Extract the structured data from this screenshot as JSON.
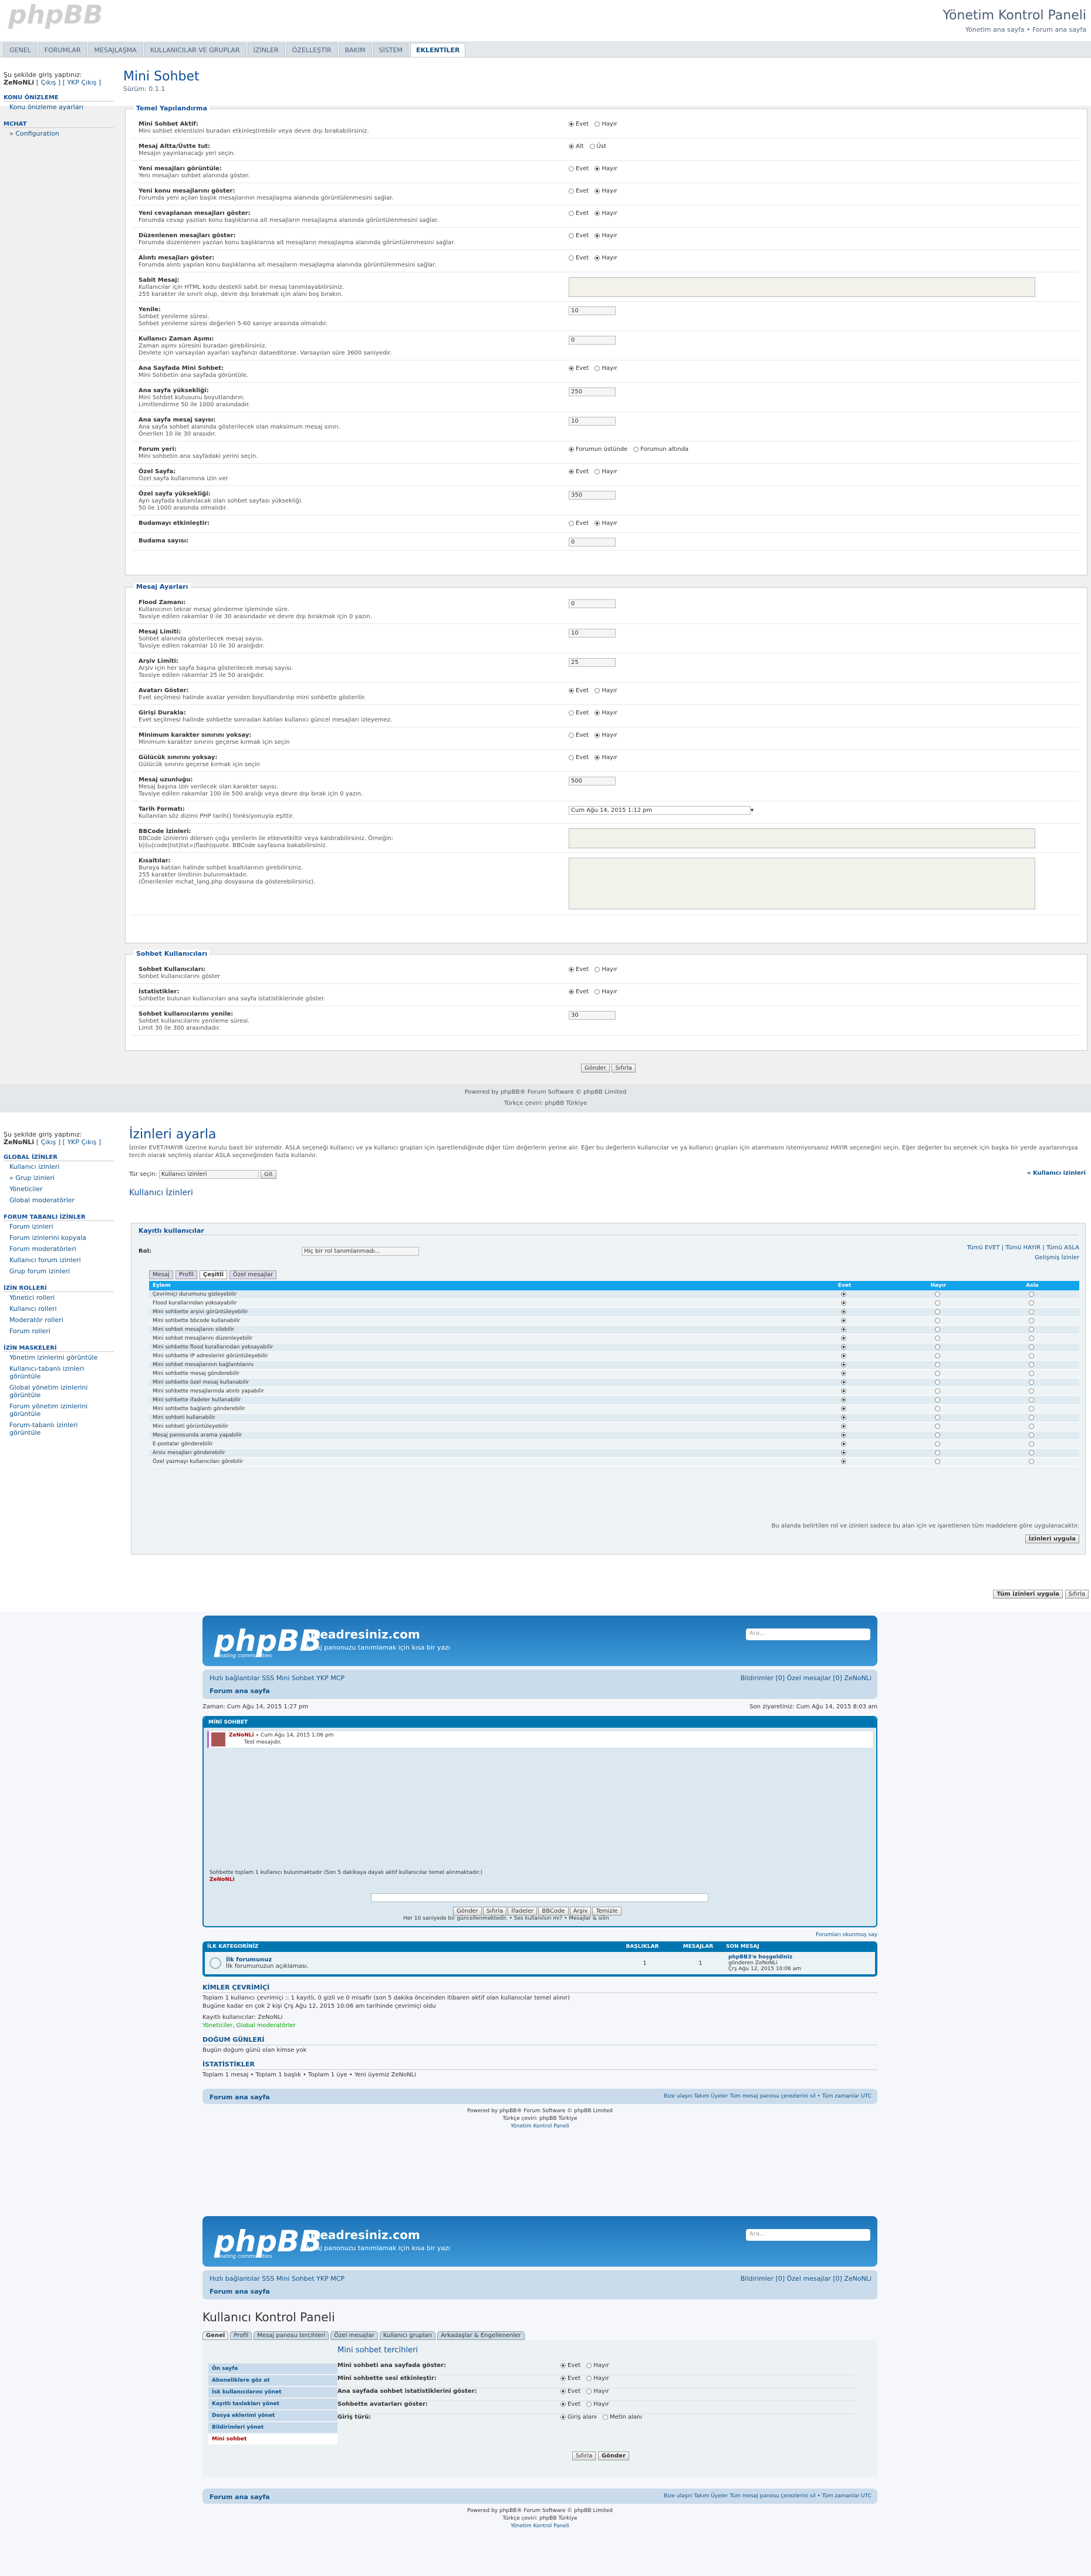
{
  "acp": {
    "logo": "phpBB",
    "title": "Yönetim Kontrol Paneli",
    "sublinks": "Yönetim ana sayfa • Forum ana sayfa",
    "tabs": [
      "GENEL",
      "FORUMLAR",
      "MESAJLAŞMA",
      "KULLANICILAR VE GRUPLAR",
      "İZİNLER",
      "ÖZELLEŞTİR",
      "BAKIM",
      "SİSTEM",
      "EKLENTİLER"
    ],
    "active_tab": "EKLENTİLER",
    "login": "Şu şekilde giriş yaptınız:",
    "user": "ZeNoNLi",
    "login_links": "[ Çıkış ] [ YKP Çıkış ]",
    "side": [
      {
        "hd": "KONU ÖNİZLEME",
        "items": [
          "Konu önizleme ayarları"
        ]
      },
      {
        "hd": "MCHAT",
        "items": [
          "» Configuration"
        ]
      }
    ],
    "page_title": "Mini Sohbet",
    "version": "Sürüm: 0.1.1",
    "general_legend": "Temel Yapılandırma",
    "general": [
      {
        "t": "Mini Sohbet Aktif:",
        "d": "Mini sohbet eklentisini buradan etkinleştirebilir veya devre dışı bırakabilirsiniz.",
        "c": "yn",
        "v": "Evet"
      },
      {
        "t": "Mesaj Altta/Üstte tut:",
        "d": "Mesajın yayınlanacağı yeri seçin.",
        "c": "radio2",
        "o": [
          "Alt",
          "Üst"
        ],
        "v": "Alt"
      },
      {
        "t": "Yeni mesajları görüntüle:",
        "d": "Yeni mesajları sohbet alanında göster.",
        "c": "yn",
        "v": "Hayır"
      },
      {
        "t": "Yeni konu mesajlarını göster:",
        "d": "Forumda yeni açılan başlık mesajlarının mesajlaşma alanında görüntülenmesini sağlar.",
        "c": "yn",
        "v": "Hayır"
      },
      {
        "t": "Yeni cevaplanan mesajları göster:",
        "d": "Forumda cevap yazılan konu başlıklarına ait mesajların mesajlaşma alanında görüntülenmesini sağlar.",
        "c": "yn",
        "v": "Hayır"
      },
      {
        "t": "Düzenlenen mesajları göster:",
        "d": "Forumda düzenlenen yazılan konu başlıklarına ait mesajların mesajlaşma alanında görüntülenmesini sağlar.",
        "c": "yn",
        "v": "Hayır"
      },
      {
        "t": "Alıntı mesajları göster:",
        "d": "Forumda alıntı yapılan konu başlıklarına ait mesajların mesajlaşma alanında görüntülenmesini sağlar.",
        "c": "yn",
        "v": "Hayır"
      },
      {
        "t": "Sabit Mesaj:",
        "d": "Kullanıcılar için HTML kodu destekli sabit bir mesaj tanımlayabilirsiniz. | 255 karakter ile sınırlı olup, devre dışı bırakmak için alanı boş bırakın.",
        "c": "ta",
        "v": ""
      },
      {
        "t": "Yenile:",
        "d": "Sohbet yenileme süresi. | Sohbet yenileme süresi değerleri 5-60 saniye arasında olmalıdır.",
        "c": "in",
        "v": "10"
      },
      {
        "t": "Kullanıcı Zaman Aşımı:",
        "d": "Zaman aşımı süresini buradan girebilirsiniz. | Devlete için varsayılan ayarları sayfanızı dataeditorse. Varsayılan süre 3600 saniyedir.",
        "c": "in",
        "v": "0"
      },
      {
        "t": "Ana Sayfada Mini Sohbet:",
        "d": "Mini Sohbetin ana sayfada görüntüle.",
        "c": "yn",
        "v": "Evet"
      },
      {
        "t": "Ana sayfa yüksekliği:",
        "d": "Mini Sohbet kutusunu boyutlandırın. | Limitlendirme 50 ile 1000 arasındadır.",
        "c": "in",
        "v": "250"
      },
      {
        "t": "Ana sayfa mesaj sayısı:",
        "d": "Ana sayfa sohbet alanında gösterilecek olan maksimum mesaj sınırı. | Önerilen 10 ile 30 arasıdır.",
        "c": "in",
        "v": "10"
      },
      {
        "t": "Forum yeri:",
        "d": "Mini sohbetin ana sayfadaki yerini seçin.",
        "c": "radio2",
        "o": [
          "Forumun üstünde",
          "Forumun altında"
        ],
        "v": "Forumun üstünde"
      },
      {
        "t": "Özel Sayfa:",
        "d": "Özel sayfa kullanımına izin ver",
        "c": "yn",
        "v": "Evet"
      },
      {
        "t": "Özel sayfa yüksekliği:",
        "d": "Ayrı sayfada kullanılacak olan sohbet sayfası yüksekliği. | 50 ile 1000 arasında olmalıdır.",
        "c": "in",
        "v": "350"
      },
      {
        "t": "Budamayı etkinleştir:",
        "d": "",
        "c": "yn",
        "v": "Hayır"
      },
      {
        "t": "Budama sayısı:",
        "d": "",
        "c": "in",
        "v": "0"
      }
    ],
    "msg_legend": "Mesaj Ayarları",
    "msg": [
      {
        "t": "Flood Zamanı:",
        "d": "Kullanıcının tekrar mesaj gönderme işleminde süre. | Tavsiye edilen rakamlar 0 ile 30 arasındadır ve devre dışı bırakmak için 0 yazın.",
        "c": "in",
        "v": "0"
      },
      {
        "t": "Mesaj Limiti:",
        "d": "Sohbet alanında gösterilecek mesaj sayısı. | Tavsiye edilen rakamlar 10 ile 30 aralığıdır.",
        "c": "in",
        "v": "10"
      },
      {
        "t": "Arşiv Limiti:",
        "d": "Arşiv için her sayfa başına gösterilecek mesaj sayısı. | Tavsiye edilen rakamlar 25 ile 50 aralığıdır.",
        "c": "in",
        "v": "25"
      },
      {
        "t": "Avatarı Göster:",
        "d": "Evet seçilmesi halinde avatar yeniden boyutlandırılıp mini sohbette gösterilir.",
        "c": "yn",
        "v": "Evet"
      },
      {
        "t": "Girişi Durakla:",
        "d": "Evet seçilmesi halinde sohbette sonradan katılan kullanıcı güncel mesajları izleyemez.",
        "c": "yn",
        "v": "Hayır"
      },
      {
        "t": "Minimum karakter sınırını yoksay:",
        "d": "Minimum karakter sınırını geçerse kırmak için seçin",
        "c": "yn",
        "v": "Hayır"
      },
      {
        "t": "Gülücük sınırını yoksay:",
        "d": "Gülücük sınırını geçerse kırmak için seçin",
        "c": "yn",
        "v": "Hayır"
      },
      {
        "t": "Mesaj uzunluğu:",
        "d": "Mesaj başına izin verilecek olan karakter sayısı. | Tavsiye edilen rakamlar 100 ile 500 aralığı veya devre dışı bırak için 0 yazın.",
        "c": "in",
        "v": "500"
      },
      {
        "t": "Tarih Formatı:",
        "d": "Kullanılan söz dizimi PHP tarih() fonksiyonuyla eşittir.",
        "c": "sel",
        "v": "Cum Ağu 14, 2015 1:12 pm"
      },
      {
        "t": "BBCode İzinleri:",
        "d": "BBCode izinlerini dilersen çoğu yenilerin ile etkevetkiltir veya kaldırabilirsiniz. Örneğin: | b|i|u|code|list|list=|flash|quote. BBCode sayfasına bakabilirsiniz.",
        "c": "ta",
        "v": ""
      },
      {
        "t": "Kısaltılar:",
        "d": "Buraya katılan halinde sohbet kısaltılarının girebilirsiniz. | 255 karakter limitinin bulunmaktadır. | (Önerilenler mchat_lang.php dosyasına da gösterebilirsiniz).",
        "c": "ta2",
        "v": ""
      }
    ],
    "who_legend": "Sohbet Kullanıcıları",
    "who": [
      {
        "t": "Sohbet Kullanıcıları:",
        "d": "Sohbet kullanıcılarını göster",
        "c": "yn",
        "v": "Evet"
      },
      {
        "t": "İstatistikler:",
        "d": "Sohbette bulunan kullanıcıları ana sayfa istatistiklerinde göster.",
        "c": "yn",
        "v": "Evet"
      },
      {
        "t": "Sohbet kullanıcılarını yenile:",
        "d": "Sohbet kullanıcılarını yenileme süresi. | Limit 30 ile 300 arasındadır.",
        "c": "in",
        "v": "30"
      }
    ],
    "submit": "Gönder",
    "reset": "Sıfırla",
    "yes": "Evet",
    "no": "Hayır",
    "footer1": "Powered by phpBB® Forum Software © phpBB Limited",
    "footer2": "Türkçe çeviri: phpBB Türkiye"
  },
  "perm": {
    "login": "Şu şekilde giriş yaptınız:",
    "user": "ZeNoNLi",
    "login_links": "[ Çıkış ] [ YKP Çıkış ]",
    "side": [
      {
        "hd": "GLOBAL İZİNLER",
        "items": [
          "Kullanıcı izinleri",
          "» Grup izinleri",
          "Yöneticiler",
          "Global moderatörler"
        ]
      },
      {
        "hd": "FORUM TABANLI İZİNLER",
        "items": [
          "Forum izinleri",
          "Forum izinlerini kopyala",
          "Forum moderatörleri",
          "Kullanıcı forum izinleri",
          "Grup forum izinleri"
        ]
      },
      {
        "hd": "İZİN ROLLERİ",
        "items": [
          "Yönetici rolleri",
          "Kullanıcı rolleri",
          "Moderatör rolleri",
          "Forum rolleri"
        ]
      },
      {
        "hd": "İZİN MASKELERİ",
        "items": [
          "Yönetim izinlerini görüntüle",
          "Kullanıcı-tabanlı izinleri görüntüle",
          "Global yönetim izinlerini görüntüle",
          "Forum yönetim izinlerini görüntüle",
          "Forum-tabanlı izinleri görüntüle"
        ]
      }
    ],
    "title": "İzinleri ayarla",
    "intro": "İzinler EVET/HAYIR üzerine kurulu basit bir sistemdir. ASLA seçeneği kullanıcı ve ya kullanıcı grupları için işaretlendiğinde diğer tüm değerlerin yerine alır. Eğer bu değerlerin kullanıcılar ve ya kullanıcı grupları için atanmasını istemiyorsanız HAYIR seçeneğini seçin. Eğer değerler bu seçenek için başka bir yerde ayarlanmışsa tercih olarak seçilmiş olanlar ASLA seçeneğinden fazla kullanılır.",
    "type_label": "Tür seçin:",
    "type_value": "Kullanıcı izinleri",
    "go": "Git",
    "right_link": "« Kullanıcı izinleri",
    "section": "Kullanıcı İzinleri",
    "group": "Kayıtlı kullanıcılar",
    "role_label": "Rol:",
    "role_value": "Hiç bir rol tanımlanmadı...",
    "all_links": "Tümü EVET | Tümü HAYIR | Tümü ASLA",
    "adv": "Gelişmiş İzinler",
    "tabs": [
      "Mesaj",
      "Profil",
      "Çeşitli",
      "Özel mesajlar"
    ],
    "cols": [
      "Eylem",
      "Evet",
      "Hayır",
      "Asla"
    ],
    "rows": [
      "Çevrimiçi durumunu gizleyebilir",
      "Flood kurallarından yoksayabilir",
      "Mini sohbette arşivi görüntüleyebilir",
      "Mini sohbette bbcode kullanabilir",
      "Mini sohbet mesajlarını silebilir",
      "Mini sohbet mesajlarını düzenleyebilir",
      "Mini sohbette flood kurallarından yoksayabilir",
      "Mini sohbette IP adreslerini görüntüleyebilir",
      "Mini sohbet mesajlarının bağlantılarını",
      "Mini sohbette mesaj gönderebilir",
      "Mini sohbette özel mesaj kullanabilir",
      "Mini sohbette mesajlarında atıntı yapabilir",
      "Mini sohbette ifadeler kullanabilir",
      "Mini sohbette bağlantı gönderebilir",
      "Mini sohbeti kullanabilir",
      "Mini sohbeti görüntüleyebilir",
      "Mesaj panosunda arama yapabilir",
      "E-postalar gönderebilir",
      "Arsiv mesajları gönderebilir",
      "Özel yazmayı kullanıcıları görebilir"
    ],
    "note": "Bu alanda belirtilen rol ve izinleri sadece bu alan için ve işaretlenen tüm maddelere göre uygulanacaktır.",
    "apply": "İzinleri uygula",
    "apply_all": "Tüm izinleri uygula",
    "reset": "Sıfırla"
  },
  "board1": {
    "site": "siteadresiniz.com",
    "desc": "Mesaj panonuzu tanımlamak için kısa bir yazı",
    "logo": "phpBB",
    "logo_sub": "creating communities",
    "search": "Ara...",
    "nav_left": "Hızlı bağlantılar  SSS  Mini Sohbet  YKP  MCP",
    "nav_right": "Bildirimler [0]  Özel mesajlar [0]  ZeNoNLi",
    "home": "Forum ana sayfa",
    "date": "Zaman: Cum Ağu 14, 2015 1:27 pm",
    "last": "Son ziyaretiniz: Cum Ağu 14, 2015 8:03 am",
    "mc_title": "MİNİ SOHBET",
    "mc_user": "ZeNoNLi",
    "mc_time": "» Cum Ağu 14, 2015 1:06 pm",
    "mc_msg": "Test mesajıdır.",
    "mc_online": "Sohbette toplam 1 kullanıcı bulunmaktadır   (Son 5 dakikaya dayalı aktif kullanıcılar temel alınmaktadır.)",
    "mc_online_user": "ZeNoNLi",
    "mc_btns": [
      "Gönder",
      "Sıfırla",
      "İfadeler",
      "BBCode",
      "Arşiv",
      "Temizle"
    ],
    "mc_refresh": "Her 10 saniyede bir güncellenmektedir.  • Ses kullanılsın mı?   • Mesajlar & silin",
    "mark": "Forumları okunmuş say",
    "cat": "İLK KATEGORİNİZ",
    "cols": [
      "BAŞLIKLAR",
      "MESAJLAR",
      "SON MESAJ"
    ],
    "forum_name": "İlk forumunuz",
    "forum_desc": "İlk forumunuzun açıklaması.",
    "topics": "1",
    "posts": "1",
    "last_title": "phpBB3'e hoşgeldiniz",
    "last_by": "gönderen ZeNoNLi",
    "last_time": "Çrş Ağu 12, 2015 10:06 am",
    "who_h": "KİMLER ÇEVRİMİÇİ",
    "who_t": "Toplam 1 kullanıcı çevrimiçi :: 1 kayıtlı, 0 gizli ve 0 misafir (son 5 dakika önceinden itibaren aktif olan kullanıcılar temel alınır)",
    "who_t2": "Bugüne kadar en çok 2 kişi Çrş Ağu 12, 2015 10:06 am tarihinde çevrimiçi oldu",
    "reg": "Kayıtlı kullanıcılar: ZeNoNLi",
    "legend": "Yöneticiler, Global moderatörler",
    "bd_h": "DOĞUM GÜNLERİ",
    "bd_t": "Bugün doğum günü olan kimse yok",
    "st_h": "İSTATİSTİKLER",
    "st_t": "Toplam 1 mesaj • Toplam 1 başlık • Toplam 1 üye • Yeni üyemiz ZeNoNLi",
    "foot_nav": "Forum ana sayfa",
    "foot_right": "Bize ulaşın  Takım  Üyeler  Tüm mesaj panosu çerezlerini sil • Tüm zamanlar UTC",
    "f1": "Powered by phpBB® Forum Software © phpBB Limited",
    "f2": "Türkçe çeviri: phpBB Türkiye",
    "f3": "Yönetim Kontrol Paneli"
  },
  "board2": {
    "title": "Kullanıcı Kontrol Paneli",
    "tabs": [
      "Genel",
      "Profil",
      "Mesaj panosu tercihleri",
      "Özel mesajlar",
      "Kullanıcı grupları",
      "Arkadaşlar & Engellenenler"
    ],
    "side": [
      "Ön sayfa",
      "Aboneliklere göz at",
      "İsk kullanıcılarını yönet",
      "Kayıtlı taslakları yönet",
      "Dosya eklerimi yönet",
      "Bildirimleri yönet",
      "Mini sohbet"
    ],
    "panel_title": "Mini sohbet tercihleri",
    "opts": [
      {
        "t": "Mini sohbeti ana sayfada göster:",
        "v": "Evet"
      },
      {
        "t": "Mini sohbette sesi etkinleştir:",
        "v": "Evet"
      },
      {
        "t": "Ana sayfada sohbet istatistiklerini göster:",
        "v": "Evet"
      },
      {
        "t": "Sohbette avatarları göster:",
        "v": "Evet"
      }
    ],
    "date_label": "Giriş türü:",
    "date_o": [
      "Giriş alanı",
      "Metin alanı"
    ],
    "reset": "Sıfırla",
    "submit": "Gönder"
  }
}
